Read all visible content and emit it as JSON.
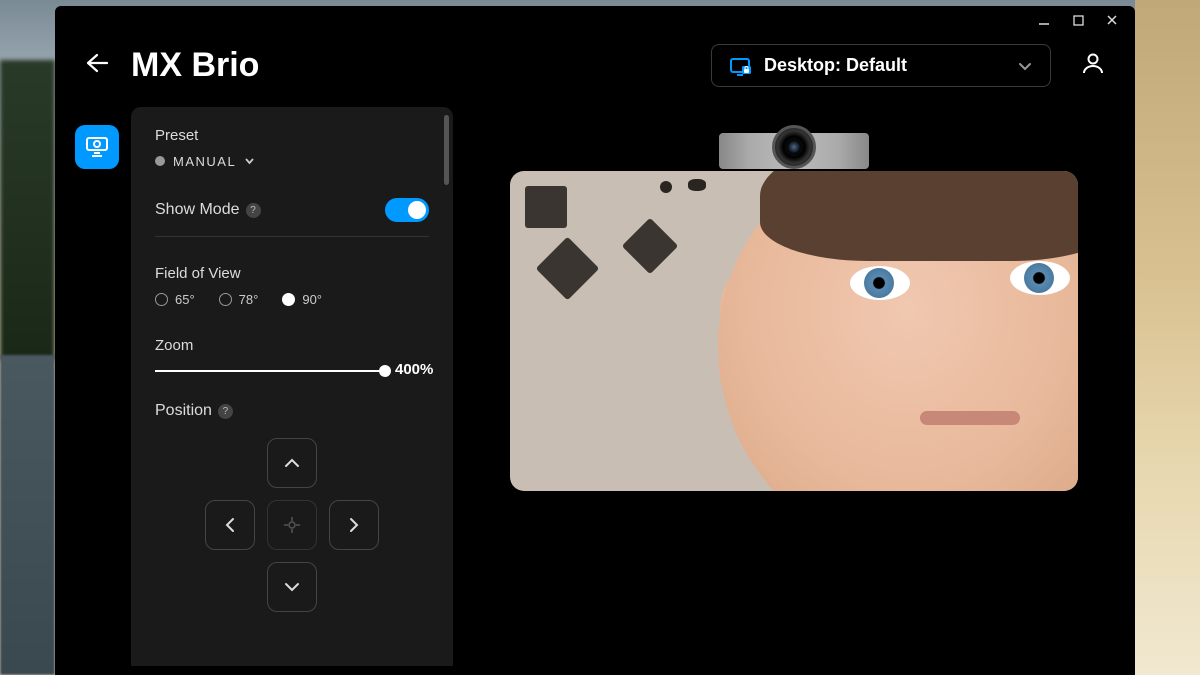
{
  "app": {
    "title": "MX Brio"
  },
  "header": {
    "profile_label": "Desktop: Default"
  },
  "settings": {
    "preset": {
      "label": "Preset",
      "value": "MANUAL"
    },
    "show_mode": {
      "label": "Show Mode",
      "enabled": true
    },
    "fov": {
      "label": "Field of View",
      "options": [
        "65°",
        "78°",
        "90°"
      ],
      "selected": "90°"
    },
    "zoom": {
      "label": "Zoom",
      "value_text": "400%",
      "value_pct": 100
    },
    "position": {
      "label": "Position"
    }
  },
  "colors": {
    "accent": "#0099ff"
  }
}
